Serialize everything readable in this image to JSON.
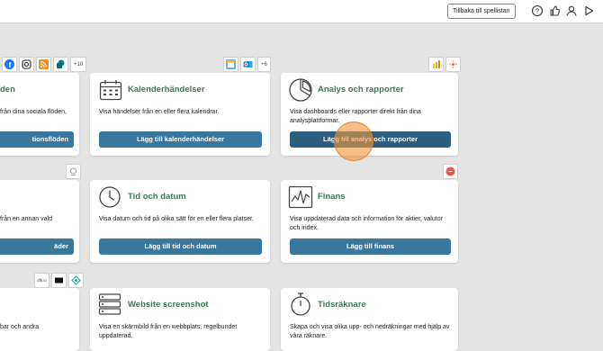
{
  "topbar": {
    "back_label": "Tillbaka till spellistan",
    "icons": [
      "help-icon",
      "thumbs-up-icon",
      "user-icon",
      "play-icon"
    ]
  },
  "cards": {
    "social": {
      "title": "den",
      "desc": "från dina sociala flöden,",
      "button": "tionsflöden",
      "sources_more": "+10"
    },
    "calendar": {
      "title": "Kalenderhändelser",
      "desc": "Visa händelser från en eller flera kalendrar.",
      "button": "Lägg till kalenderhändelser",
      "sources_more": "+6"
    },
    "analytics": {
      "title": "Analys och rapporter",
      "desc": "Visa dashboards eller rapporter direkt från dina analysplattformar.",
      "button": "Lägg till analys och rapporter"
    },
    "embed": {
      "desc": "från en annan vald",
      "button": "äder"
    },
    "time": {
      "title": "Tid och datum",
      "desc": "Visa datum och tid på olika sätt för en eller flera platser.",
      "button": "Lägg till tid och datum"
    },
    "finance": {
      "title": "Finans",
      "desc": "Visa uppdaterad data och information för aktier, valutor och index.",
      "button": "Lägg till finans"
    },
    "partial3": {
      "desc": "bar och andra",
      "badge": "dfk.io"
    },
    "website": {
      "title": "Website screenshot",
      "desc": "Visa en skärmbild från en webbplats, regelbundet uppdaterad."
    },
    "countdown": {
      "title": "Tidsräknare",
      "desc": "Skapa och visa olika upp- och nedräkningar med hjälp av våra räknare."
    }
  },
  "colors": {
    "accent_green": "#3d7a52",
    "button_blue": "#3a779c",
    "highlight": "#f0963c"
  }
}
